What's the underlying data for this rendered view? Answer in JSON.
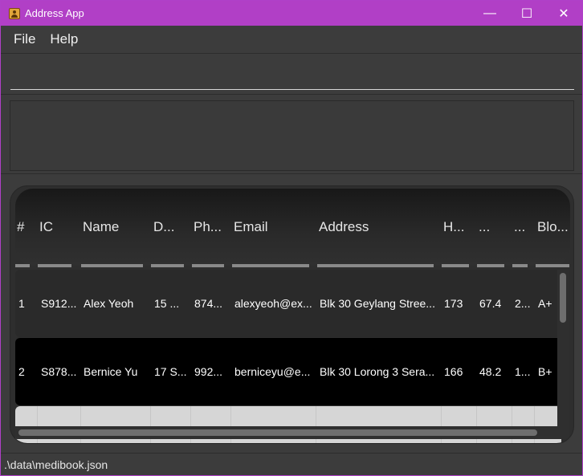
{
  "window": {
    "title": "Address App",
    "icon": "address-book-icon",
    "controls": {
      "minimize": "—",
      "maximize": "☐",
      "close": "✕"
    }
  },
  "menu": {
    "items": [
      "File",
      "Help"
    ]
  },
  "command_box": {
    "value": "",
    "placeholder": ""
  },
  "result_display": {
    "text": ""
  },
  "table": {
    "columns": [
      "#",
      "IC",
      "Name",
      "D...",
      "Ph...",
      "Email",
      "Address",
      "H...",
      "...",
      "...",
      "Blo..."
    ],
    "rows": [
      [
        "1",
        "S912...",
        "Alex Yeoh",
        "15 ...",
        "874...",
        "alexyeoh@ex...",
        "Blk 30 Geylang Stree...",
        "173",
        "67.4",
        "2...",
        "A+"
      ],
      [
        "2",
        "S878...",
        "Bernice Yu",
        "17 S...",
        "992...",
        "berniceyu@e...",
        "Blk 30 Lorong 3 Sera...",
        "166",
        "48.2",
        "1...",
        "B+"
      ]
    ]
  },
  "status_bar": {
    "file_path": ".\\data\\medibook.json"
  },
  "colors": {
    "title_bar": "#b13fc6",
    "background": "#3c3c3c",
    "row_odd": "#2a2a2a",
    "row_even": "#000000"
  }
}
